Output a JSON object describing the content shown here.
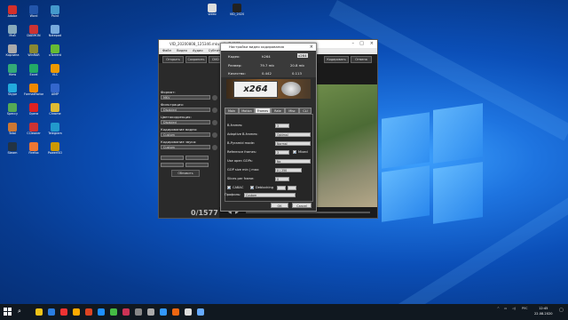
{
  "colors": {
    "desktop": "#0b4fb8",
    "taskbar": "#101820",
    "dialog": "#2d2d2d"
  },
  "desktop_icons": [
    {
      "label": "Adobe",
      "color": "#d4302b"
    },
    {
      "label": "Мой",
      "color": "#8ab"
    },
    {
      "label": "Корзина",
      "color": "#aaa"
    },
    {
      "label": "Hiew",
      "color": "#3a7"
    },
    {
      "label": "Skype",
      "color": "#2ad"
    },
    {
      "label": "Speccy",
      "color": "#5a5"
    },
    {
      "label": "Total",
      "color": "#c73"
    },
    {
      "label": "Steam",
      "color": "#234"
    },
    {
      "label": "Word",
      "color": "#25a"
    },
    {
      "label": "DAEMON",
      "color": "#c33"
    },
    {
      "label": "WinRAR",
      "color": "#883"
    },
    {
      "label": "Excel",
      "color": "#2a6"
    },
    {
      "label": "FormatFactory",
      "color": "#e80"
    },
    {
      "label": "Opera",
      "color": "#d22"
    },
    {
      "label": "CCleaner",
      "color": "#c33"
    },
    {
      "label": "Firefox",
      "color": "#e73"
    },
    {
      "label": "Paint",
      "color": "#49c"
    },
    {
      "label": "Notepad",
      "color": "#7ad"
    },
    {
      "label": "uTorrent",
      "color": "#6b3"
    },
    {
      "label": "VLC",
      "color": "#e90"
    },
    {
      "label": "AIMP",
      "color": "#36c"
    },
    {
      "label": "Chrome",
      "color": "#db3"
    },
    {
      "label": "Telegram",
      "color": "#29c"
    },
    {
      "label": "PowerISO",
      "color": "#c90"
    }
  ],
  "top_icons": [
    {
      "label": "video",
      "color": "#fff"
    },
    {
      "label": "VID_2020",
      "color": "#222"
    }
  ],
  "app": {
    "title": "VID_20200808_125346.mkv - XviD4PSP",
    "menu": [
      "Файл",
      "Видео",
      "Аудио",
      "Субтитры",
      "Настройки",
      "Сервис",
      "Справка"
    ],
    "toolbar": [
      "Открыть",
      "Сохранить",
      "DVD",
      "Кодировать",
      "Отмена"
    ],
    "left": {
      "format_label": "Формат:",
      "format_value": "MKV",
      "filter_label": "Фильтрация:",
      "filter_value": "Disabled",
      "color_label": "Цветокоррекция:",
      "color_value": "Disabled",
      "vcodec_label": "Кодирование видео:",
      "vcodec_value": "Custom",
      "acodec_label": "Кодирование звука:",
      "acodec_value": "Custom",
      "refresh_btn": "Обновить"
    },
    "counter": "0/1577"
  },
  "dialog": {
    "title": "Настройки видео кодирования",
    "codec_label": "Кодек:",
    "codec_value": "h264",
    "codec_sel": "x264",
    "size_label": "Размер:",
    "size_a": "79.7 mb",
    "size_b": "20.8 mb",
    "quality_label": "Качество:",
    "quality_a": "0.442",
    "quality_b": "0.113",
    "banner": "x264",
    "tabs": [
      "Main",
      "Motion",
      "Frames",
      "Rate",
      "Misc",
      "CLI"
    ],
    "active_tab": "Frames",
    "rows": [
      {
        "label": "B-frames:",
        "value": "3"
      },
      {
        "label": "Adaptive B-frames:",
        "value": "Optimal"
      },
      {
        "label": "B-Pyramid mode:",
        "value": "Normal"
      },
      {
        "label": "Reference frames:",
        "value": "3"
      },
      {
        "label": "Use open GOPs:",
        "value": "No"
      },
      {
        "label": "GOP size min | max:",
        "value": "0 | 250"
      },
      {
        "label": "Slices per frame:",
        "value": "0"
      }
    ],
    "mixed": "Mixed",
    "cabac": "CABAC",
    "deblocking": "Deblocking",
    "profile_label": "Профиль:",
    "profile_value": "Custom",
    "ok": "OK",
    "cancel": "Cancel"
  },
  "taskbar": {
    "lang": "РУС",
    "time": "12:45",
    "date": "22.08.2020",
    "apps": [
      {
        "color": "#f0c419"
      },
      {
        "color": "#2a7de1"
      },
      {
        "color": "#e33"
      },
      {
        "color": "#fa0"
      },
      {
        "color": "#d42"
      },
      {
        "color": "#1e90ff"
      },
      {
        "color": "#4b4"
      },
      {
        "color": "#c35"
      },
      {
        "color": "#888"
      },
      {
        "color": "#aaa"
      },
      {
        "color": "#39f"
      },
      {
        "color": "#e61"
      },
      {
        "color": "#ddd"
      },
      {
        "color": "#6af"
      }
    ]
  }
}
